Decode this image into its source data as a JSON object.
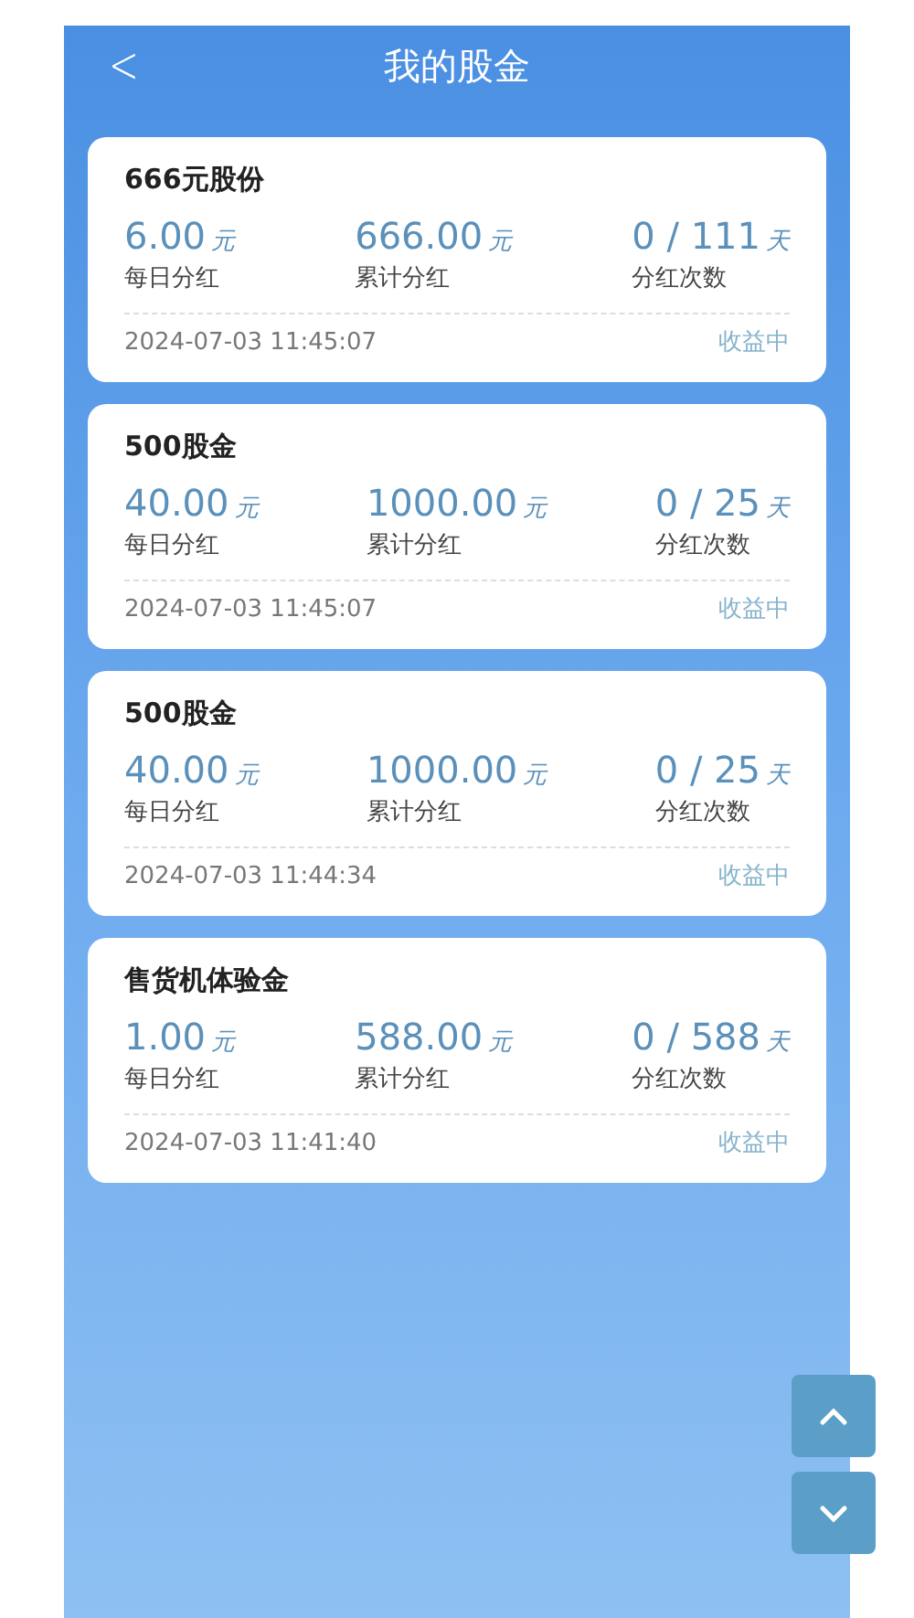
{
  "header": {
    "back": "<",
    "title": "我的股金"
  },
  "cards": [
    {
      "title": "666元股份",
      "stats": [
        {
          "value": "6.00",
          "unit": "元",
          "label": "每日分红"
        },
        {
          "value": "666.00",
          "unit": "元",
          "label": "累计分红"
        },
        {
          "value": "0 / 111",
          "unit": "天",
          "label": "分红次数"
        }
      ],
      "time": "2024-07-03 11:45:07",
      "status": "收益中"
    },
    {
      "title": "500股金",
      "stats": [
        {
          "value": "40.00",
          "unit": "元",
          "label": "每日分红"
        },
        {
          "value": "1000.00",
          "unit": "元",
          "label": "累计分红"
        },
        {
          "value": "0 / 25",
          "unit": "天",
          "label": "分红次数"
        }
      ],
      "time": "2024-07-03 11:45:07",
      "status": "收益中"
    },
    {
      "title": "500股金",
      "stats": [
        {
          "value": "40.00",
          "unit": "元",
          "label": "每日分红"
        },
        {
          "value": "1000.00",
          "unit": "元",
          "label": "累计分红"
        },
        {
          "value": "0 / 25",
          "unit": "天",
          "label": "分红次数"
        }
      ],
      "time": "2024-07-03 11:44:34",
      "status": "收益中"
    },
    {
      "title": "售货机体验金",
      "stats": [
        {
          "value": "1.00",
          "unit": "元",
          "label": "每日分红"
        },
        {
          "value": "588.00",
          "unit": "元",
          "label": "累计分红"
        },
        {
          "value": "0 / 588",
          "unit": "天",
          "label": "分红次数"
        }
      ],
      "time": "2024-07-03 11:41:40",
      "status": "收益中"
    }
  ]
}
